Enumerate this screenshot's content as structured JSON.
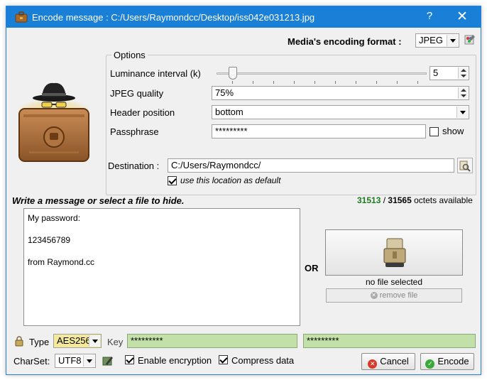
{
  "window": {
    "title": "Encode message : C:/Users/Raymondcc/Desktop/iss042e031213.jpg",
    "help_glyph": "?",
    "close_glyph": "✕"
  },
  "format": {
    "label": "Media's encoding format :",
    "value": "JPEG"
  },
  "options": {
    "group_label": "Options",
    "luminance": {
      "label": "Luminance interval (k)",
      "value": "5",
      "slider_fraction": 0.0
    },
    "jpeg_quality": {
      "label": "JPEG quality",
      "value": "75%"
    },
    "header_position": {
      "label": "Header position",
      "value": "bottom"
    },
    "passphrase": {
      "label": "Passphrase",
      "value": "*********",
      "show_label": "show",
      "show_checked": false
    },
    "destination": {
      "label": "Destination :",
      "value": "C:/Users/Raymondcc/",
      "default_label": "use this location as default",
      "default_checked": true
    }
  },
  "message": {
    "prompt": "Write a message or select a file to hide.",
    "octets_used": "31513",
    "octets_sep": " / ",
    "octets_total": "31565",
    "octets_suffix": " octets available",
    "lines": [
      "My password:",
      "123456789",
      "from Raymond.cc"
    ],
    "or_label": "OR",
    "no_file_label": "no file selected",
    "remove_file_label": "remove file"
  },
  "encryption": {
    "type_label": "Type",
    "type_value": "AES256",
    "key_label": "Key",
    "key_value": "*********",
    "key_confirm_value": "*********",
    "charset_label": "CharSet:",
    "charset_value": "UTF8",
    "enable_label": "Enable encryption",
    "enable_checked": true,
    "compress_label": "Compress data",
    "compress_checked": true
  },
  "buttons": {
    "cancel": "Cancel",
    "encode": "Encode"
  },
  "colors": {
    "titlebar": "#1a7fd6",
    "octets_used": "#1e7a1e",
    "key_field": "#c2e0a8",
    "type_field": "#f4e99a"
  },
  "icons": {
    "app": "briefcase-icon",
    "format_tool": "palette-icon",
    "main": "spy-briefcase-icon",
    "browse": "folder-search-icon",
    "package": "package-icon",
    "remove": "remove-icon",
    "lock": "lock-icon",
    "charset_tool": "pen-icon",
    "cancel": "cancel-icon",
    "encode": "check-icon"
  }
}
